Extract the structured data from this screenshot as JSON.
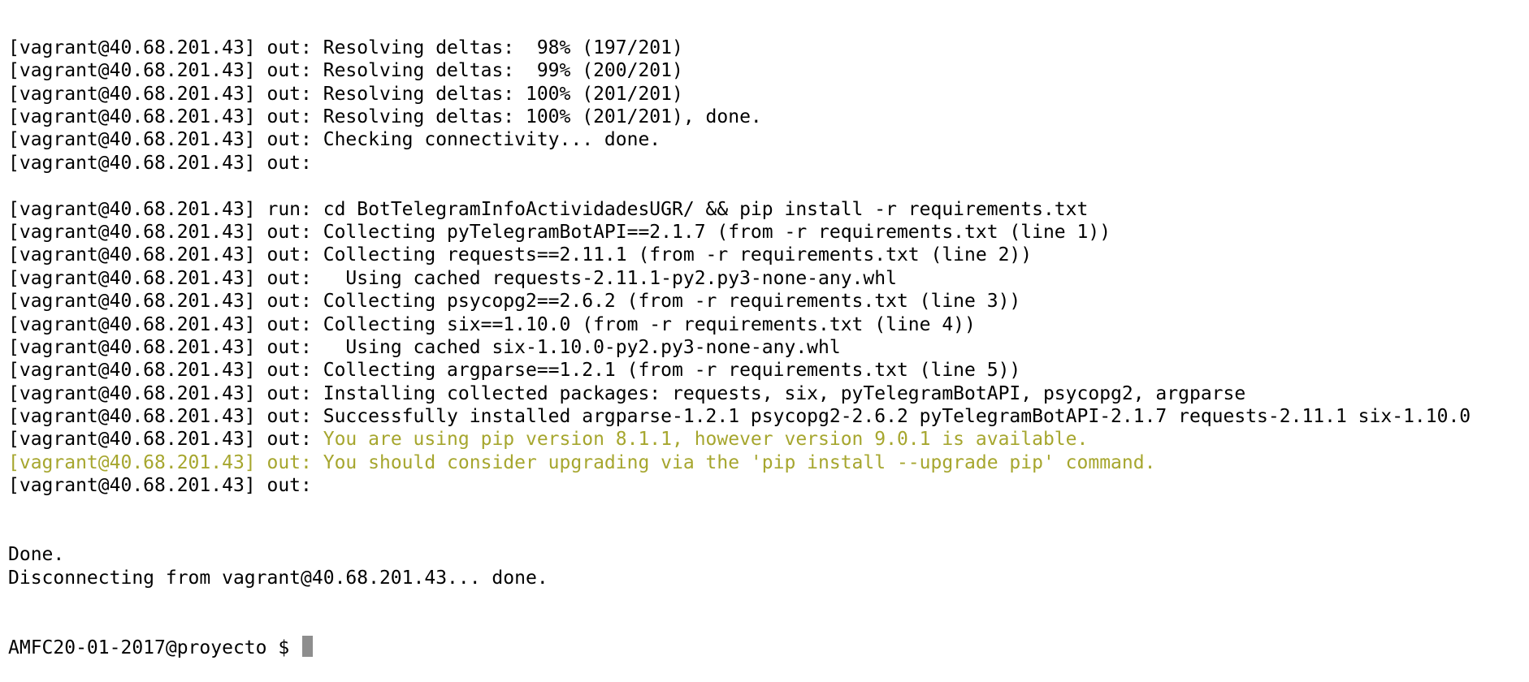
{
  "terminal": {
    "lines": [
      {
        "prefix": "[vagrant@40.68.201.43] out: ",
        "text": "Resolving deltas:  98% (197/201)",
        "style": "normal"
      },
      {
        "prefix": "[vagrant@40.68.201.43] out: ",
        "text": "Resolving deltas:  99% (200/201)",
        "style": "normal"
      },
      {
        "prefix": "[vagrant@40.68.201.43] out: ",
        "text": "Resolving deltas: 100% (201/201)",
        "style": "normal"
      },
      {
        "prefix": "[vagrant@40.68.201.43] out: ",
        "text": "Resolving deltas: 100% (201/201), done.",
        "style": "normal"
      },
      {
        "prefix": "[vagrant@40.68.201.43] out: ",
        "text": "Checking connectivity... done.",
        "style": "normal"
      },
      {
        "prefix": "[vagrant@40.68.201.43] out:",
        "text": "",
        "style": "normal"
      },
      {
        "prefix": "",
        "text": "",
        "style": "normal"
      },
      {
        "prefix": "[vagrant@40.68.201.43] run: ",
        "text": "cd BotTelegramInfoActividadesUGR/ && pip install -r requirements.txt",
        "style": "normal"
      },
      {
        "prefix": "[vagrant@40.68.201.43] out: ",
        "text": "Collecting pyTelegramBotAPI==2.1.7 (from -r requirements.txt (line 1))",
        "style": "normal"
      },
      {
        "prefix": "[vagrant@40.68.201.43] out: ",
        "text": "Collecting requests==2.11.1 (from -r requirements.txt (line 2))",
        "style": "normal"
      },
      {
        "prefix": "[vagrant@40.68.201.43] out: ",
        "text": "  Using cached requests-2.11.1-py2.py3-none-any.whl",
        "style": "normal"
      },
      {
        "prefix": "[vagrant@40.68.201.43] out: ",
        "text": "Collecting psycopg2==2.6.2 (from -r requirements.txt (line 3))",
        "style": "normal"
      },
      {
        "prefix": "[vagrant@40.68.201.43] out: ",
        "text": "Collecting six==1.10.0 (from -r requirements.txt (line 4))",
        "style": "normal"
      },
      {
        "prefix": "[vagrant@40.68.201.43] out: ",
        "text": "  Using cached six-1.10.0-py2.py3-none-any.whl",
        "style": "normal"
      },
      {
        "prefix": "[vagrant@40.68.201.43] out: ",
        "text": "Collecting argparse==1.2.1 (from -r requirements.txt (line 5))",
        "style": "normal"
      },
      {
        "prefix": "[vagrant@40.68.201.43] out: ",
        "text": "Installing collected packages: requests, six, pyTelegramBotAPI, psycopg2, argparse",
        "style": "normal"
      },
      {
        "prefix": "[vagrant@40.68.201.43] out: ",
        "text": "Successfully installed argparse-1.2.1 psycopg2-2.6.2 pyTelegramBotAPI-2.1.7 requests-2.11.1 six-1.10.0",
        "style": "normal"
      },
      {
        "prefix": "[vagrant@40.68.201.43] out: ",
        "text": "You are using pip version 8.1.1, however version 9.0.1 is available.",
        "style": "warn"
      },
      {
        "prefix": "[vagrant@40.68.201.43] out: ",
        "text": "You should consider upgrading via the 'pip install --upgrade pip' command.",
        "style": "warn-full"
      },
      {
        "prefix": "[vagrant@40.68.201.43] out:",
        "text": "",
        "style": "normal"
      },
      {
        "prefix": "",
        "text": "",
        "style": "normal"
      },
      {
        "prefix": "",
        "text": "",
        "style": "normal"
      },
      {
        "prefix": "",
        "text": "Done.",
        "style": "normal"
      },
      {
        "prefix": "",
        "text": "Disconnecting from vagrant@40.68.201.43... done.",
        "style": "normal"
      }
    ],
    "prompt": "AMFC20-01-2017@proyecto $ ",
    "colors": {
      "foreground": "#000000",
      "warning": "#a6a62e",
      "background": "#ffffff",
      "cursor": "#8e8e8e"
    }
  }
}
